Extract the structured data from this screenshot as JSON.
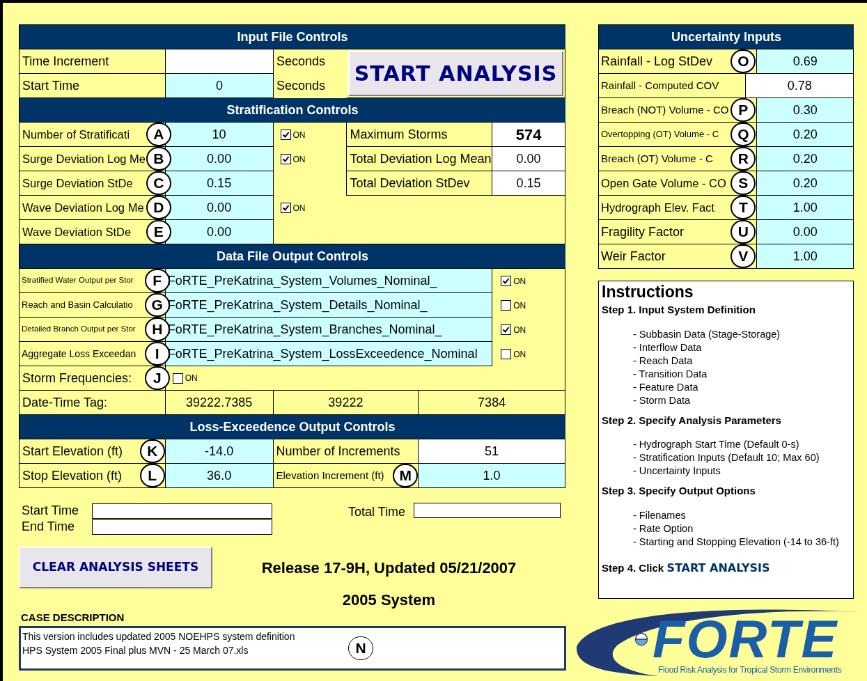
{
  "input_file_controls": {
    "title": "Input File Controls",
    "rows": [
      {
        "label": "Time Increment",
        "kind": "output",
        "unit": "Seconds"
      },
      {
        "label": "Start Time",
        "kind": "input",
        "value": "0",
        "unit": "Seconds"
      }
    ],
    "start_button": "START ANALYSIS"
  },
  "stratification_controls": {
    "title": "Stratification Controls",
    "rows": [
      {
        "label": "Number of Stratificati",
        "marker": "A",
        "value": "10",
        "toggle": {
          "label": "ON",
          "checked": true
        }
      },
      {
        "label": "Surge Deviation Log Me",
        "marker": "B",
        "value": "0.00",
        "toggle": {
          "label": "ON",
          "checked": true
        }
      },
      {
        "label": "Surge Deviation StDe",
        "marker": "C",
        "value": "0.15"
      },
      {
        "label": "Wave Deviation Log Me",
        "marker": "D",
        "value": "0.00",
        "toggle": {
          "label": "ON",
          "checked": true
        }
      },
      {
        "label": "Wave Deviation StDe",
        "marker": "E",
        "value": "0.00"
      }
    ],
    "summary": [
      {
        "label": "Maximum Storms",
        "value": "574",
        "bold": true
      },
      {
        "label": "Total Deviation Log Mean",
        "value": "0.00",
        "bold": false
      },
      {
        "label": "Total Deviation StDev",
        "value": "0.15",
        "bold": false
      }
    ]
  },
  "data_file_output_controls": {
    "title": "Data File Output Controls",
    "rows": [
      {
        "label": "Stratified Water Output per Stor",
        "marker": "F",
        "filename": "FoRTE_PreKatrina_System_Volumes_Nominal_",
        "toggle": {
          "label": "ON",
          "checked": true
        }
      },
      {
        "label": "Reach and Basin Calculatio",
        "marker": "G",
        "filename": "FoRTE_PreKatrina_System_Details_Nominal_",
        "toggle": {
          "label": "ON",
          "checked": false
        }
      },
      {
        "label": "Detailed Branch Output per Stor",
        "marker": "H",
        "filename": "FoRTE_PreKatrina_System_Branches_Nominal_",
        "toggle": {
          "label": "ON",
          "checked": true
        }
      },
      {
        "label": "Aggregate Loss Exceedan",
        "marker": "I",
        "filename": "FoRTE_PreKatrina_System_LossExceedence_Nominal",
        "toggle": {
          "label": "ON",
          "checked": false
        }
      }
    ],
    "storm_frequencies": {
      "label": "Storm Frequencies:",
      "marker": "J",
      "toggle": {
        "label": "ON",
        "checked": false
      }
    },
    "date_time_tag": {
      "label": "Date-Time Tag:",
      "values": [
        "39222.7385",
        "39222",
        "7384"
      ]
    }
  },
  "loss_exceedence_output_controls": {
    "title": "Loss-Exceedence Output Controls",
    "rows": [
      {
        "cells": [
          {
            "label": "Start Elevation (ft)",
            "marker": "K",
            "value": "-14.0",
            "kind": "input"
          },
          {
            "label": "Number of Increments",
            "value": "51",
            "kind": "output"
          }
        ]
      },
      {
        "cells": [
          {
            "label": "Stop Elevation (ft)",
            "marker": "L",
            "value": "36.0",
            "kind": "input"
          },
          {
            "label": "Elevation Increment (ft)",
            "marker": "M",
            "value": "1.0",
            "kind": "input"
          }
        ]
      }
    ]
  },
  "timing": {
    "fields": [
      {
        "label": "Start Time"
      },
      {
        "label": "End Time"
      }
    ],
    "total_time": {
      "label": "Total Time"
    }
  },
  "clear_button": "CLEAR ANALYSIS SHEETS",
  "release": "Release 17-9H, Updated 05/21/2007",
  "system": "2005 System",
  "case_description": {
    "label": "CASE DESCRIPTION",
    "lines": [
      "This version includes updated 2005 NOEHPS system definition",
      "HPS System 2005 Final plus MVN - 25 March 07.xls"
    ],
    "marker": "N"
  },
  "uncertainty_inputs": {
    "title": "Uncertainty Inputs",
    "rows": [
      {
        "label": "Rainfall - Log StDev",
        "marker": "O",
        "value": "0.69",
        "kind": "input"
      },
      {
        "label": "Rainfall - Computed COV",
        "value": "0.78",
        "kind": "output"
      },
      {
        "label": "Breach (NOT) Volume - CO",
        "marker": "P",
        "value": "0.30",
        "kind": "input"
      },
      {
        "label": "Overtopping (OT) Volume - C",
        "marker": "Q",
        "value": "0.20",
        "kind": "input"
      },
      {
        "label": "Breach (OT) Volume - C",
        "marker": "R",
        "value": "0.20",
        "kind": "input"
      },
      {
        "label": "Open Gate Volume - CO",
        "marker": "S",
        "value": "0.20",
        "kind": "input"
      },
      {
        "label": "Hydrograph Elev. Fact",
        "marker": "T",
        "value": "1.00",
        "kind": "input"
      },
      {
        "label": "Fragility Factor",
        "marker": "U",
        "value": "0.00",
        "kind": "input"
      },
      {
        "label": "Weir Factor",
        "marker": "V",
        "value": "1.00",
        "kind": "input"
      }
    ]
  },
  "instructions": {
    "title": "Instructions",
    "steps": [
      {
        "heading": "Step 1. Input System Definition",
        "items": [
          "- Subbasin Data (Stage-Storage)",
          "- Interflow Data",
          "- Reach Data",
          "- Transition Data",
          "- Feature Data",
          "- Storm Data"
        ]
      },
      {
        "heading": "Step 2. Specify Analysis Parameters",
        "items": [
          "- Hydrograph Start Time (Default 0-s)",
          "- Stratification Inputs (Default 10; Max 60)",
          "- Uncertainty Inputs"
        ]
      },
      {
        "heading": "Step 3. Specify Output Options",
        "items": [
          "- Filenames",
          "- Rate Option",
          "- Starting and Stopping Elevation (-14 to 36-ft)"
        ]
      },
      {
        "heading": "Step 4. Click",
        "action": "START ANALYSIS"
      }
    ]
  },
  "logo": {
    "name": "FORTE",
    "tagline": "Flood Risk Analysis for Tropical Storm Environments"
  }
}
